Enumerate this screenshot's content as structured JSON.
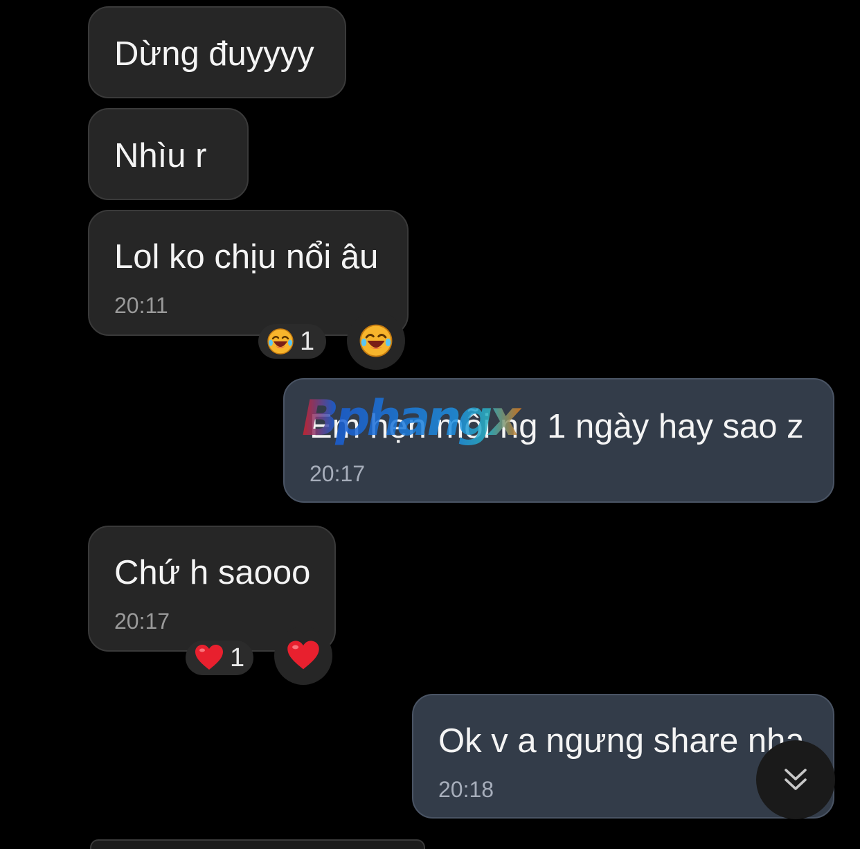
{
  "messages": [
    {
      "direction": "incoming",
      "text": "Dừng đuyyyy",
      "time": ""
    },
    {
      "direction": "incoming",
      "text": "Nhìu r",
      "time": ""
    },
    {
      "direction": "incoming",
      "text": "Lol ko chịu nổi âu",
      "time": "20:11",
      "reaction": {
        "emoji_name": "laughing-crying-face",
        "emoji": "😆",
        "count": "1"
      }
    },
    {
      "direction": "outgoing",
      "text": "Em hẹn mỗi ng 1 ngày hay sao z",
      "time": "20:17"
    },
    {
      "direction": "incoming",
      "text": "Chứ h saooo",
      "time": "20:17",
      "reaction": {
        "emoji_name": "red-heart",
        "emoji": "❤️",
        "count": "1"
      }
    },
    {
      "direction": "outgoing",
      "text": "Ok v a ngưng share nha",
      "time": "20:18"
    }
  ],
  "watermark": {
    "text": "Bphangx"
  },
  "scroll_button": {
    "icon": "double-chevron-down-icon"
  },
  "colors": {
    "background": "#000000",
    "incoming_bubble": "#262626",
    "outgoing_bubble": "#333c49",
    "timestamp": "#9a9a9a"
  }
}
